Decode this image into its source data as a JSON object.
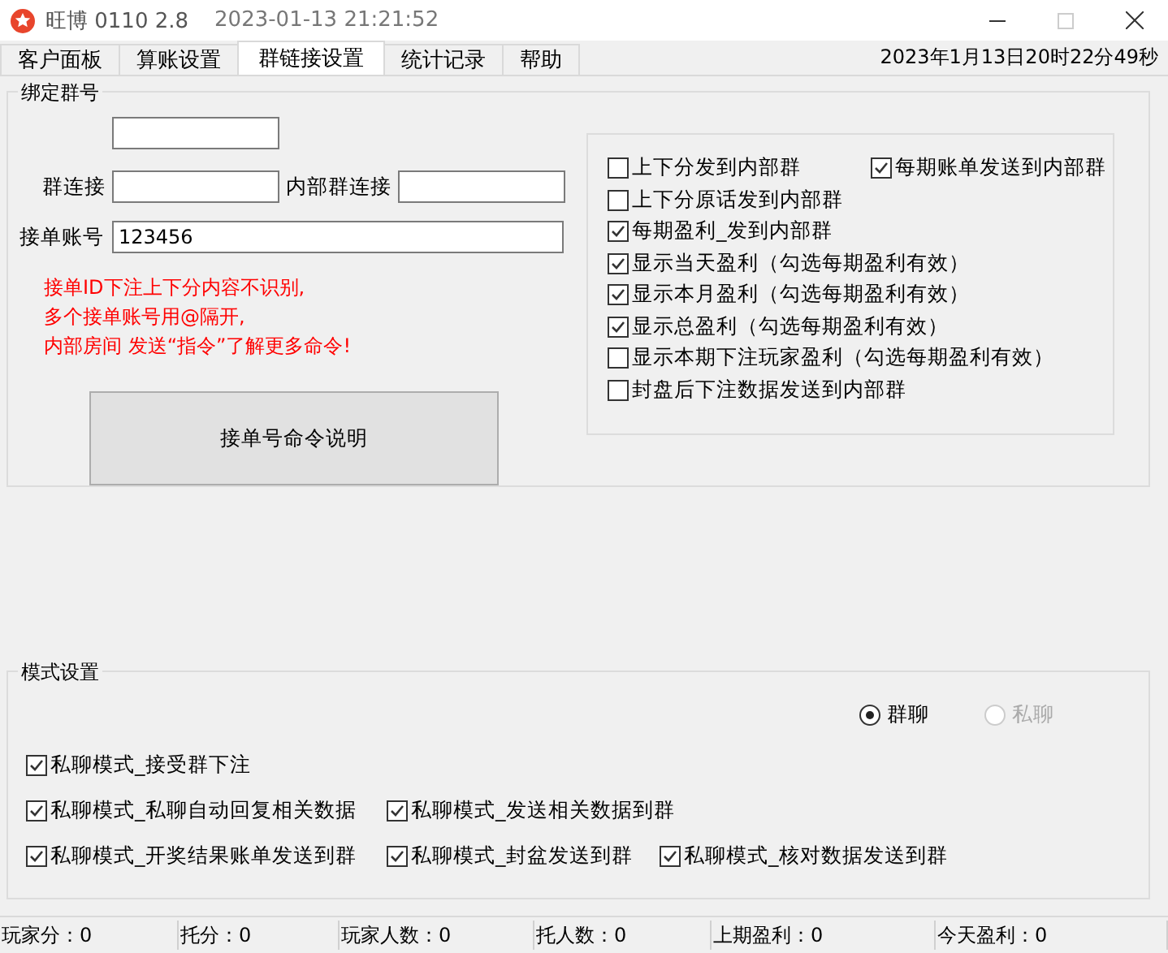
{
  "window": {
    "app_name": "旺博 0110 2.8",
    "timestamp": "2023-01-13 21:21:52",
    "maximize_disabled": true
  },
  "tabs": [
    {
      "label": "客户面板",
      "selected": false
    },
    {
      "label": "算账设置",
      "selected": false
    },
    {
      "label": "群链接设置",
      "selected": true
    },
    {
      "label": "统计记录",
      "selected": false
    },
    {
      "label": "帮助",
      "selected": false
    }
  ],
  "clock": "2023年1月13日20时22分49秒",
  "bind_group": {
    "title": "绑定群号",
    "group_link_label": "群连接",
    "internal_link_label": "内部群连接",
    "order_account_label": "接单账号",
    "order_account_value": "123456",
    "notes": [
      "接单ID下注上下分内容不识别,",
      "多个接单账号用@隔开,",
      "内部房间 发送“指令”了解更多命令!"
    ],
    "help_button": "接单号命令说明"
  },
  "options": [
    {
      "label": "上下分发到内部群",
      "checked": false
    },
    {
      "label": "每期账单发送到内部群",
      "checked": true
    },
    {
      "label": "上下分原话发到内部群",
      "checked": false
    },
    {
      "label": "每期盈利_发到内部群",
      "checked": true
    },
    {
      "label": "显示当天盈利（勾选每期盈利有效）",
      "checked": true
    },
    {
      "label": "显示本月盈利（勾选每期盈利有效）",
      "checked": true
    },
    {
      "label": "显示总盈利（勾选每期盈利有效）",
      "checked": true
    },
    {
      "label": "显示本期下注玩家盈利（勾选每期盈利有效）",
      "checked": false
    },
    {
      "label": "封盘后下注数据发送到内部群",
      "checked": false
    }
  ],
  "mode": {
    "title": "模式设置",
    "radios": [
      {
        "label": "群聊",
        "selected": true,
        "disabled": false
      },
      {
        "label": "私聊",
        "selected": false,
        "disabled": true
      }
    ],
    "rows": [
      [
        {
          "label": "私聊模式_接受群下注",
          "checked": true
        }
      ],
      [
        {
          "label": "私聊模式_私聊自动回复相关数据",
          "checked": true
        },
        {
          "label": "私聊模式_发送相关数据到群",
          "checked": true
        }
      ],
      [
        {
          "label": "私聊模式_开奖结果账单发送到群",
          "checked": true
        },
        {
          "label": "私聊模式_封盆发送到群",
          "checked": true
        },
        {
          "label": "私聊模式_核对数据发送到群",
          "checked": true
        }
      ]
    ]
  },
  "status_bar": [
    "玩家分：0",
    "托分：0",
    "玩家人数：0",
    "托人数：0",
    "上期盈利：0",
    "今天盈利：0"
  ]
}
